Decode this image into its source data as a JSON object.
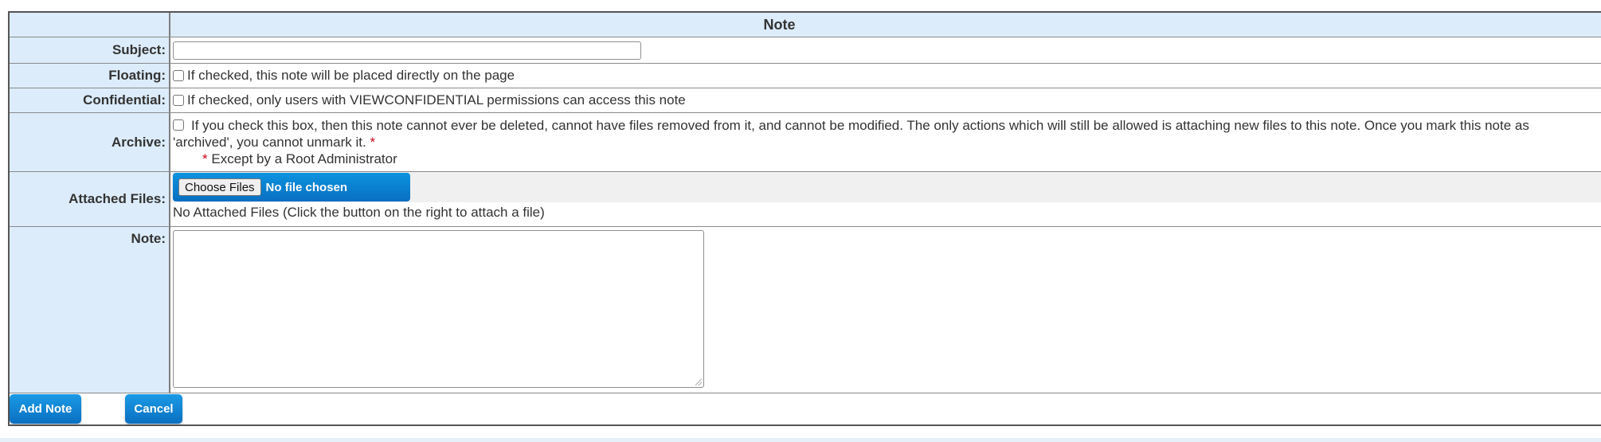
{
  "form": {
    "header": "Note",
    "subject_label": "Subject:",
    "subject_value": "",
    "floating_label": "Floating:",
    "floating_text": "If checked, this note will be placed directly on the page",
    "confidential_label": "Confidential:",
    "confidential_text": "If checked, only users with VIEWCONFIDENTIAL permissions can access this note",
    "archive_label": "Archive:",
    "archive_text": "If you check this box, then this note cannot ever be deleted, cannot have files removed from it, and cannot be modified. The only actions which will still be allowed is attaching new files to this note. Once you mark this note as",
    "archive_text_2": "'archived', you cannot unmark it.",
    "archive_star": "*",
    "except_star": "*",
    "except_text": "Except by a Root Administrator",
    "files_label": "Attached Files:",
    "choose_files": "Choose Files",
    "no_file_chosen": "No file chosen",
    "no_attached": "No Attached Files (Click the button on the right to attach a file)",
    "note_label": "Note:",
    "note_value": ""
  },
  "actions": {
    "add_note": "Add Note",
    "cancel": "Cancel"
  },
  "colors": {
    "label_bg": "#dcecfb",
    "button_blue": "#0a6fc0",
    "required_star": "#d0021b"
  }
}
